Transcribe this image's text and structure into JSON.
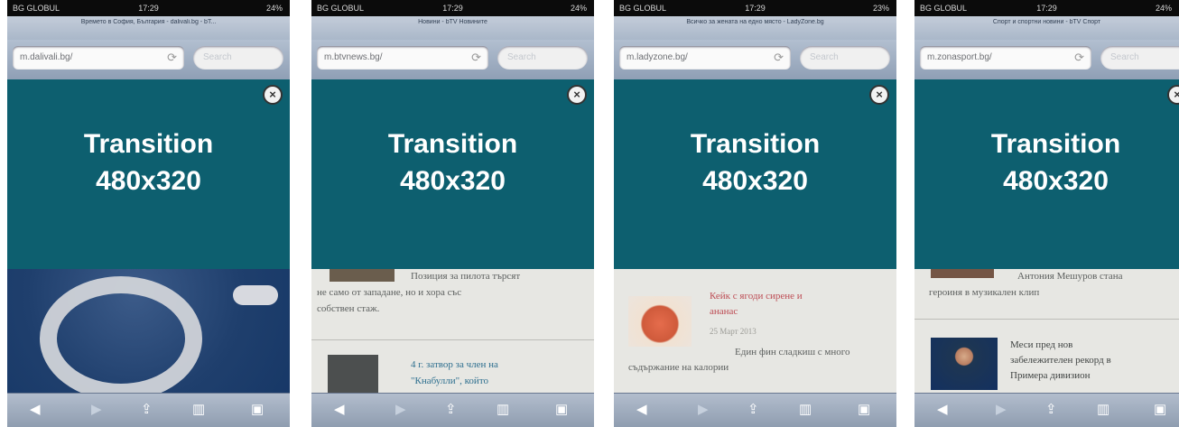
{
  "phones": [
    {
      "statusbar": {
        "carrier": "BG GLOBUL",
        "time": "17:29",
        "battery": "24%"
      },
      "page_title": "Времето в София, България - dalivali.bg - bT...",
      "url": "m.dalivali.bg/",
      "search_placeholder": "Search",
      "ad": {
        "title": "Transition",
        "size": "480x320"
      },
      "content": {}
    },
    {
      "statusbar": {
        "carrier": "BG GLOBUL",
        "time": "17:29",
        "battery": "24%"
      },
      "page_title": "Новини - bTV Новините",
      "url": "m.btvnews.bg/",
      "search_placeholder": "Search",
      "ad": {
        "title": "Transition",
        "size": "480x320"
      },
      "content": {
        "line1": "Позиция за пилота търсят",
        "line2": "не само от западане, но и хора със",
        "line3": "собствен стаж.",
        "headline1": "4 г. затвор за член на",
        "headline2": "\"Кнабулли\", който"
      }
    },
    {
      "statusbar": {
        "carrier": "BG GLOBUL",
        "time": "17:29",
        "battery": "23%"
      },
      "page_title": "Всичко за жената на едно място - LadyZone.bg",
      "url": "m.ladyzone.bg/",
      "search_placeholder": "Search",
      "ad": {
        "title": "Transition",
        "size": "480x320"
      },
      "content": {
        "headline1": "Кейк с ягоди сирене и",
        "headline2": "ананас",
        "date": "25 Март 2013",
        "line1": "Един фин сладкиш с много",
        "line2": "съдържание на калории"
      }
    },
    {
      "statusbar": {
        "carrier": "BG GLOBUL",
        "time": "17:29",
        "battery": "24%"
      },
      "page_title": "Спорт и спортни новини - bTV Спорт",
      "url": "m.zonasport.bg/",
      "search_placeholder": "Search",
      "ad": {
        "title": "Transition",
        "size": "480x320"
      },
      "content": {
        "line1": "Антония Мешуров стана",
        "line2": "героиня в музикален клип",
        "headline1": "Меси пред нов",
        "headline2": "забележителен рекорд в",
        "headline3": "Примера дивизион"
      }
    }
  ],
  "toolbar": {
    "back_icon": "back-arrow-icon",
    "forward_icon": "forward-arrow-icon",
    "share_icon": "share-icon",
    "bookmarks_icon": "bookmarks-icon",
    "tabs_icon": "tabs-icon"
  },
  "colors": {
    "ad_background": "#0d5f6f",
    "ad_text": "#ffffff",
    "toolbar": "#a3b0c2",
    "status_bar": "#0b0b0b",
    "link_blue": "#2e6f8f",
    "link_red": "#bd4c54"
  }
}
